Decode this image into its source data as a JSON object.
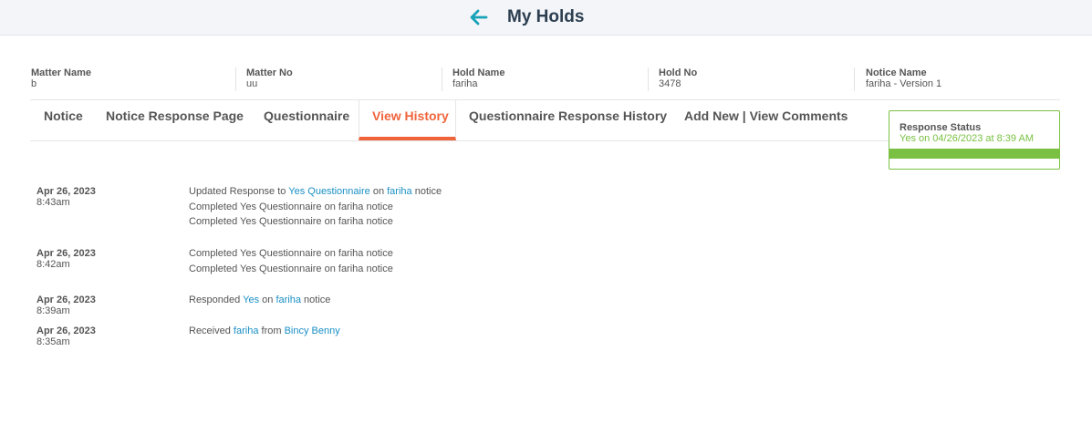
{
  "header": {
    "title": "My Holds",
    "back_icon": "arrow-left-icon",
    "accent": "#17a2b8"
  },
  "meta": [
    {
      "label": "Matter Name",
      "value": "b"
    },
    {
      "label": "Matter No",
      "value": "uu"
    },
    {
      "label": "Hold Name",
      "value": "fariha"
    },
    {
      "label": "Hold No",
      "value": "3478"
    },
    {
      "label": "Notice Name",
      "value": "fariha - Version 1"
    }
  ],
  "tabs": [
    {
      "label": "Notice",
      "active": false
    },
    {
      "label": "Notice Response Page",
      "active": false
    },
    {
      "label": "Questionnaire",
      "active": false
    },
    {
      "label": "View History",
      "active": true
    },
    {
      "label": "Questionnaire Response History",
      "active": false
    },
    {
      "label": "Add New | View Comments",
      "active": false
    }
  ],
  "response_status": {
    "title": "Response Status",
    "value": "Yes on 04/26/2023 at 8:39 AM",
    "color": "#7ac143"
  },
  "history": [
    {
      "date": "Apr 26, 2023",
      "time": "8:43am",
      "entries": [
        {
          "p1": "Updated Response to ",
          "link1": "Yes Questionnaire",
          "p2": " on ",
          "link2": "fariha",
          "p3": " notice"
        },
        {
          "text": "Completed Yes Questionnaire on fariha notice"
        },
        {
          "text": "Completed Yes Questionnaire on fariha notice"
        }
      ]
    },
    {
      "date": "Apr 26, 2023",
      "time": "8:42am",
      "entries": [
        {
          "text": "Completed Yes Questionnaire on fariha notice"
        },
        {
          "text": "Completed Yes Questionnaire on fariha notice"
        }
      ]
    },
    {
      "date": "Apr 26, 2023",
      "time": "8:39am",
      "entries": [
        {
          "p1": "Responded ",
          "link1": "Yes",
          "p2": " on ",
          "link2": "fariha",
          "p3": " notice"
        }
      ]
    },
    {
      "date": "Apr 26, 2023",
      "time": "8:35am",
      "entries": [
        {
          "p1": "Received ",
          "link1": "fariha",
          "p2": " from ",
          "link2": "Bincy Benny",
          "p3": ""
        }
      ]
    }
  ]
}
